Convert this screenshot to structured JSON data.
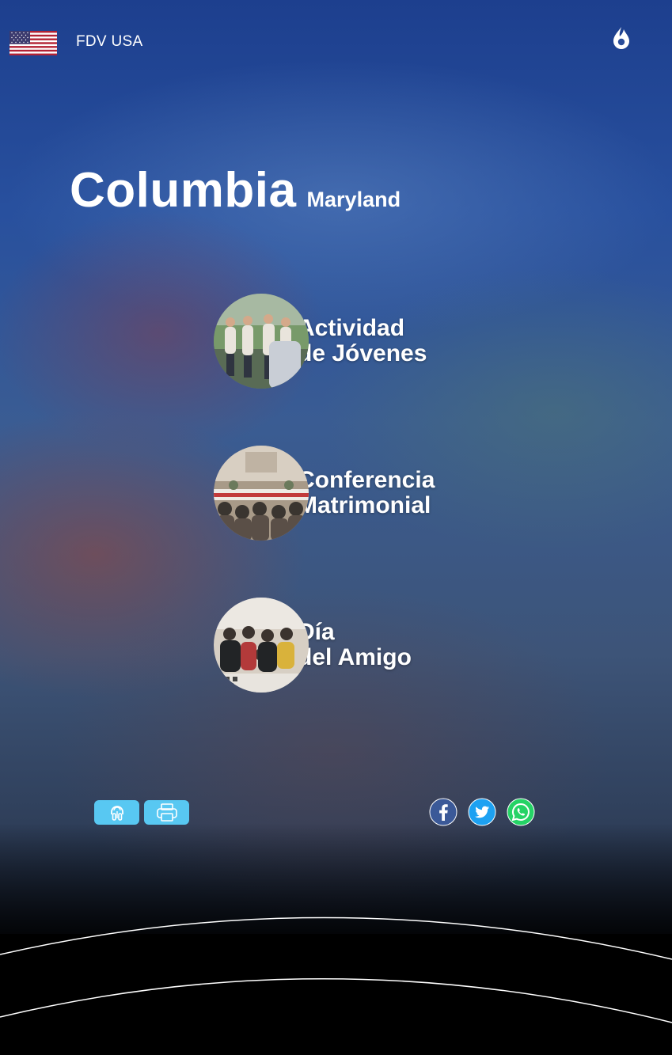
{
  "header": {
    "brand": "FDV USA"
  },
  "title": {
    "city": "Columbia",
    "state": "Maryland"
  },
  "activities": [
    {
      "line1": "Actividad",
      "line2": "de Jóvenes"
    },
    {
      "line1": "Conferencia",
      "line2": "Matrimonial"
    },
    {
      "line1": "Día",
      "line2": "del Amigo"
    }
  ],
  "colors": {
    "accent": "#58c8f2",
    "facebook": "#3b5998",
    "twitter": "#1da1f2",
    "whatsapp": "#25d366"
  },
  "icons": {
    "flag": "us-flag-icon",
    "logo": "flame-logo-icon",
    "listen": "listen-icon",
    "print": "printer-icon",
    "facebook": "facebook-icon",
    "twitter": "twitter-icon",
    "whatsapp": "whatsapp-icon"
  }
}
